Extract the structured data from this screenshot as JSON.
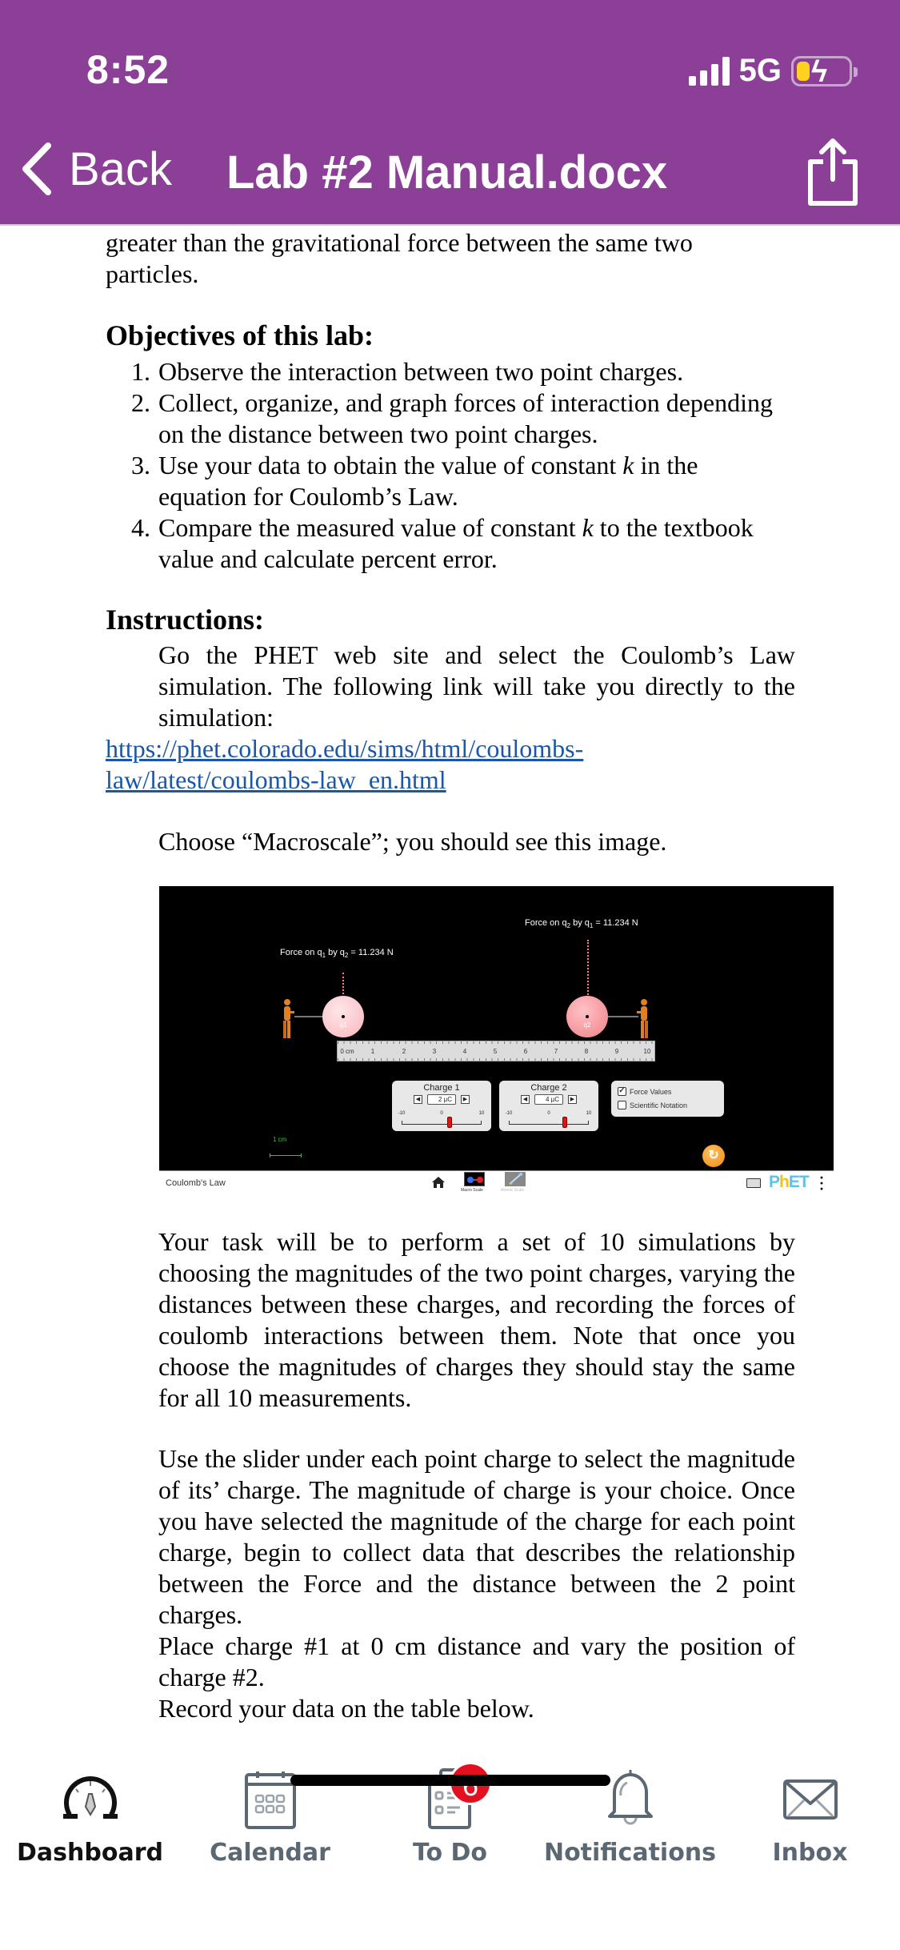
{
  "status_bar": {
    "time": "8:52",
    "network": "5G",
    "signal_bars": 4,
    "battery_level_fraction": 0.25,
    "battery_charging": true
  },
  "header": {
    "back_label": "Back",
    "title": "Lab #2 Manual.docx",
    "share_icon": "share-icon",
    "bg_color": "#8c3f96"
  },
  "document": {
    "intro_continuation_lines": [
      "greater than the gravitational force between the same two",
      "particles."
    ],
    "objectives_heading": "Objectives of this lab:",
    "objectives": [
      {
        "num": "1.",
        "text": "Observe the interaction between two point charges."
      },
      {
        "num": "2.",
        "text": "Collect, organize, and graph forces of interaction depending on the distance between two point charges."
      },
      {
        "num": "3.",
        "text_before": "Use your data to obtain the value of constant ",
        "var": "k",
        "text_after": " in the equation for Coulomb’s Law."
      },
      {
        "num": "4.",
        "text_before": "Compare the measured value of constant ",
        "var": "k",
        "text_after": " to the textbook value and calculate percent error."
      }
    ],
    "instructions_heading": "Instructions:",
    "instructions_text": "Go the PHET web site and select the Coulomb’s Law simulation. The following link will take you directly to the simulation:",
    "link_lines": [
      "https://phet.colorado.edu/sims/html/coulombs-",
      "law/latest/coulombs-law_en.html"
    ],
    "choose_text": "Choose “Macroscale”; you should see this image.",
    "task_text": "Your task will be to perform a set of 10 simulations by choosing the magnitudes of the two point charges, varying the distances between these charges, and recording the forces of coulomb interactions between them. Note that once you choose the magnitudes of charges they should stay the same for all 10 measurements.",
    "slider_text": "Use the slider under each point charge to select the magnitude of its’ charge. The magnitude of charge is your choice. Once you have selected the magnitude of the charge for each point charge, begin to collect data that describes the relationship between the Force and the distance between the 2 point charges.",
    "place_text": "Place charge #1 at 0 cm distance and vary the position of charge #2.",
    "record_text": "Record your data on the table below."
  },
  "simulation": {
    "force_q1_prefix": "Force on q",
    "force_q1": {
      "a": "1",
      "b": "2",
      "value": "= 11.234 N"
    },
    "force_q2": {
      "a": "2",
      "b": "1",
      "value": "= 11.234 N"
    },
    "charge1_name": "q1",
    "charge2_name": "q2",
    "charge1_position_cm": 0,
    "charge2_position_cm": 8,
    "ruler_unit": "0 cm",
    "ruler_ticks": [
      "1",
      "2",
      "3",
      "4",
      "5",
      "6",
      "7",
      "8",
      "9",
      "10"
    ],
    "panels": [
      {
        "title": "Charge 1",
        "value": "2 µC",
        "min": "-10",
        "mid": "0",
        "max": "10",
        "slider_value": 2
      },
      {
        "title": "Charge 2",
        "value": "4 µC",
        "min": "-10",
        "mid": "0",
        "max": "10",
        "slider_value": 4
      }
    ],
    "options": [
      {
        "label": "Force Values",
        "checked": true
      },
      {
        "label": "Scientific Notation",
        "checked": false
      }
    ],
    "scale_label": "1 cm",
    "footer_title": "Coulomb's Law",
    "screens": [
      {
        "label": "Macro Scale",
        "active": true
      },
      {
        "label": "Atomic Scale",
        "active": false
      }
    ],
    "logo_p": "P",
    "logo_h": "h",
    "logo_et": "ET"
  },
  "tabbar": {
    "items": [
      {
        "label": "Dashboard",
        "icon": "dashboard-icon",
        "active": true
      },
      {
        "label": "Calendar",
        "icon": "calendar-icon",
        "active": false
      },
      {
        "label": "To Do",
        "icon": "todo-icon",
        "active": false,
        "badge": "6"
      },
      {
        "label": "Notifications",
        "icon": "bell-icon",
        "active": false
      },
      {
        "label": "Inbox",
        "icon": "inbox-icon",
        "active": false
      }
    ],
    "badge_color": "#e5101f"
  }
}
